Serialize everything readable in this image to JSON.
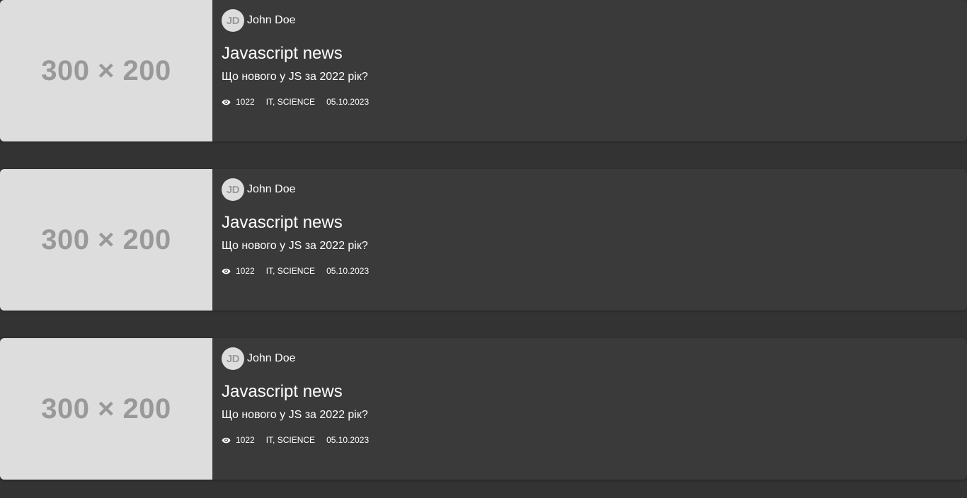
{
  "posts": [
    {
      "thumbnail_text": "300 × 200",
      "author": {
        "initials": "JD",
        "name": "John Doe"
      },
      "title": "Javascript news",
      "subtitle": "Що нового у JS за 2022 рік?",
      "views": "1022",
      "tags": "IT, SCIENCE",
      "date": "05.10.2023"
    },
    {
      "thumbnail_text": "300 × 200",
      "author": {
        "initials": "JD",
        "name": "John Doe"
      },
      "title": "Javascript news",
      "subtitle": "Що нового у JS за 2022 рік?",
      "views": "1022",
      "tags": "IT, SCIENCE",
      "date": "05.10.2023"
    },
    {
      "thumbnail_text": "300 × 200",
      "author": {
        "initials": "JD",
        "name": "John Doe"
      },
      "title": "Javascript news",
      "subtitle": "Що нового у JS за 2022 рік?",
      "views": "1022",
      "tags": "IT, SCIENCE",
      "date": "05.10.2023"
    }
  ],
  "icons": {
    "views": "eye-icon"
  },
  "colors": {
    "background": "#333333",
    "card": "#3a3a3a",
    "placeholder": "#dddddd",
    "placeholder_text": "#999999",
    "text": "#ffffff"
  }
}
